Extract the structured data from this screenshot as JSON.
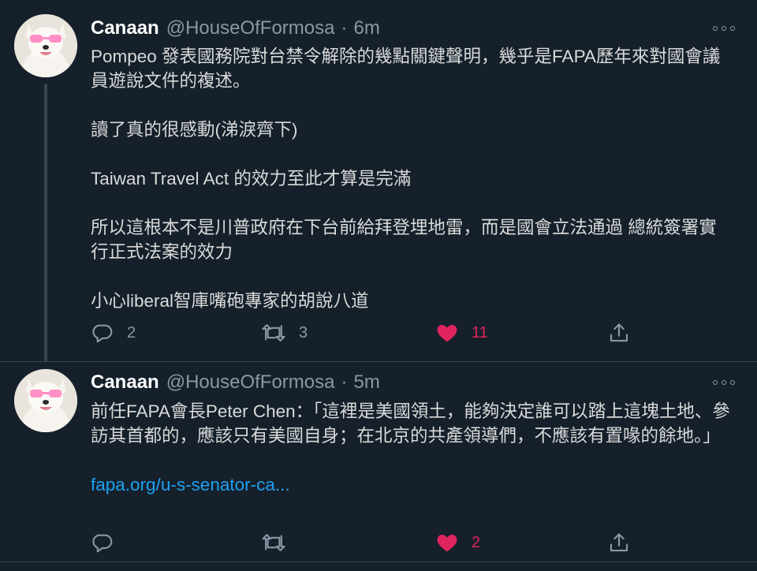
{
  "colors": {
    "background": "#15202b",
    "text": "#d9d9d9",
    "muted": "#8899a6",
    "link": "#1da1f2",
    "like": "#e0245e",
    "divider": "#38444d"
  },
  "tweets": [
    {
      "display_name": "Canaan",
      "handle": "@HouseOfFormosa",
      "separator": "·",
      "time": "6m",
      "avatar": "dog-avatar",
      "paragraphs": [
        "Pompeo 發表國務院對台禁令解除的幾點關鍵聲明，幾乎是FAPA歷年來對國會議員遊說文件的複述。",
        "讀了真的很感動(涕淚齊下)",
        "Taiwan Travel Act 的效力至此才算是完滿",
        "所以這根本不是川普政府在下台前給拜登埋地雷，而是國會立法通過 總統簽署實行正式法案的效力",
        "小心liberal智庫嘴砲專家的胡說八道"
      ],
      "link": "",
      "reply_count": "2",
      "retweet_count": "3",
      "like_count": "11",
      "liked": true
    },
    {
      "display_name": "Canaan",
      "handle": "@HouseOfFormosa",
      "separator": "·",
      "time": "5m",
      "avatar": "dog-avatar",
      "paragraphs": [
        "前任FAPA會長Peter Chen：「這裡是美國領土，能夠決定誰可以踏上這塊土地、參訪其首都的，應該只有美國自身；在北京的共產領導們，不應該有置喙的餘地。」"
      ],
      "link": "fapa.org/u-s-senator-ca...",
      "reply_count": "",
      "retweet_count": "",
      "like_count": "2",
      "liked": true
    }
  ]
}
